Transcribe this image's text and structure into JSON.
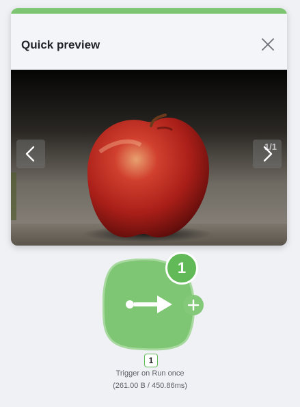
{
  "preview": {
    "title": "Quick preview",
    "counter": "1/1",
    "accent_color": "#7dc571",
    "image_subject": "red apple on gravel",
    "icons": {
      "close": "close-icon",
      "prev": "chevron-left-icon",
      "next": "chevron-right-icon"
    }
  },
  "node": {
    "badge_count": "1",
    "tag": "1",
    "label": "Trigger on Run once",
    "stats": "(261.00 B / 450.86ms)",
    "color": "#7dc571",
    "icons": {
      "main": "trigger-arrow-icon",
      "add": "plus-icon"
    }
  }
}
